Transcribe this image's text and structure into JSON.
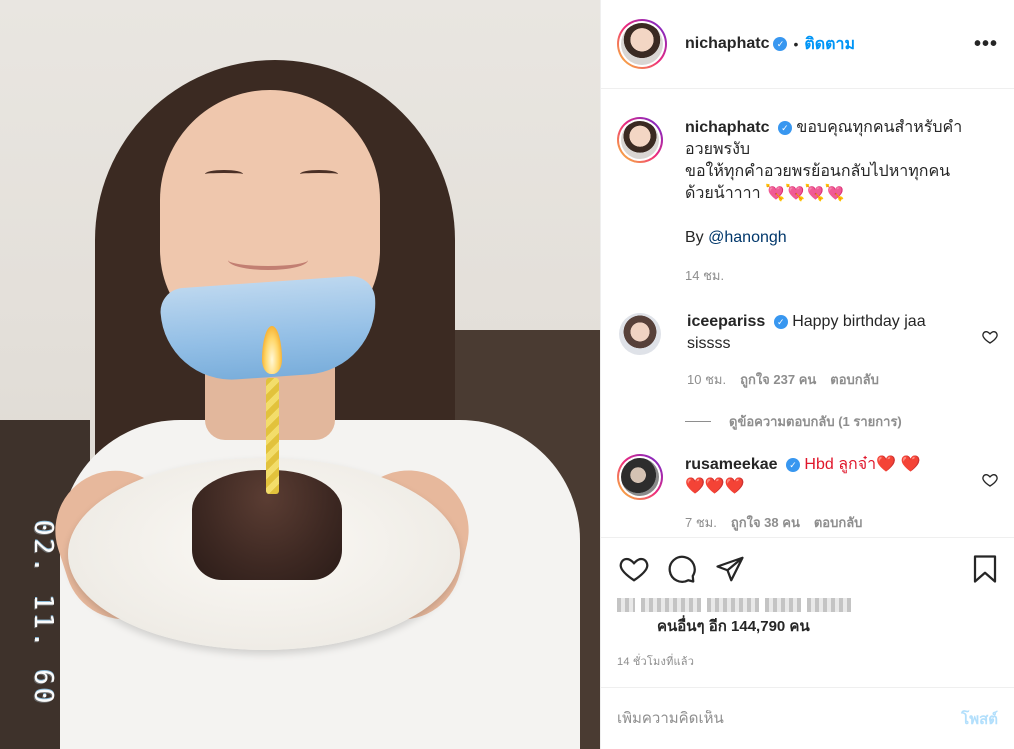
{
  "photo": {
    "timestamp_text": "02. 11. 60"
  },
  "header": {
    "username": "nichaphatc",
    "separator": "•",
    "follow_label": "ติดตาม",
    "more_label": "•••"
  },
  "caption": {
    "username": "nichaphatc",
    "lines": [
      "ขอบคุณทุกคนสำหรับคำ",
      "อวยพรงับ",
      "ขอให้ทุกคำอวยพรย้อนกลับไปหาทุกคน",
      "ด้วยน้าาาา 💘💘💘💘"
    ],
    "by_label": "By",
    "mention": "@hanongh",
    "time": "14 ชม."
  },
  "comments": [
    {
      "username": "iceepariss",
      "text_line1": "Happy birthday jaa",
      "text_line2": "sissss",
      "time": "10 ชม.",
      "likes": "ถูกใจ 237 คน",
      "reply_label": "ตอบกลับ",
      "view_replies": "ดูข้อความตอบกลับ (1 รายการ)"
    },
    {
      "username": "rusameekae",
      "text_line1": "Hbd ลูกจ๋า❤️ ❤️",
      "text_line2": "❤️❤️❤️",
      "time": "7 ชม.",
      "likes": "ถูกใจ 38 คน",
      "reply_label": "ตอบกลับ"
    }
  ],
  "actions": {
    "likes_text": "คนอื่นๆ อีก 144,790 คน",
    "post_time": "14 ชั่วโมงที่แล้ว"
  },
  "add_comment": {
    "placeholder": "เพิ่มความคิดเห็น",
    "post_label": "โพสต์"
  },
  "colors": {
    "accent_blue": "#0095f6",
    "verified_blue": "#3897f0",
    "muted_text": "#8e8e8e",
    "post_disabled": "#b2dffc"
  },
  "icons": [
    "verified-icon",
    "more-options-icon",
    "heart-icon",
    "comment-icon",
    "share-icon",
    "bookmark-icon"
  ]
}
